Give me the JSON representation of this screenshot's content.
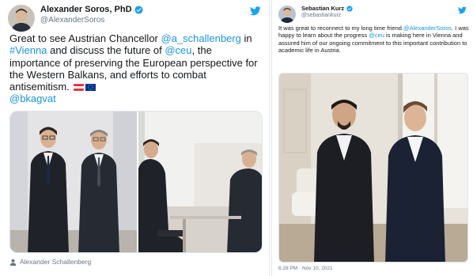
{
  "left_tweet": {
    "author": {
      "display_name": "Alexander Soros, PhD",
      "handle": "@AlexanderSoros"
    },
    "text": {
      "t1": "Great to see Austrian Chancellor ",
      "m1": "@a_schallenberg",
      "t2": " in ",
      "h1": "#Vienna",
      "t3": " and discuss the future of ",
      "m2": "@ceu",
      "t4": ", the importance of preserving the European perspective for the Western Balkans, and efforts to combat antisemitism. ",
      "m3": "@bkagvat"
    },
    "media_tag": "Alexander Schallenberg"
  },
  "right_tweet": {
    "author": {
      "display_name": "Sebastian Kurz",
      "handle": "@sebastiankurz"
    },
    "text": {
      "t1": "It was great to reconnect to my long time friend ",
      "m1": "@AlexanderSoros",
      "t2": ". I was happy to learn about the progress ",
      "m2": "@ceu",
      "t3": " is making here in Vienna and assured him of our ongoing commitment to this important contribution to academic life in Austria."
    },
    "timestamp": "6:28 PM · Nov 10, 2021"
  },
  "colors": {
    "link": "#1b95e0",
    "verified": "#1da1f2",
    "secondary_text": "#657786",
    "border": "#e1e8ed"
  },
  "icons": [
    "verified-badge-icon",
    "twitter-bird-icon",
    "austria-flag-icon",
    "eu-flag-icon",
    "person-tag-icon"
  ]
}
